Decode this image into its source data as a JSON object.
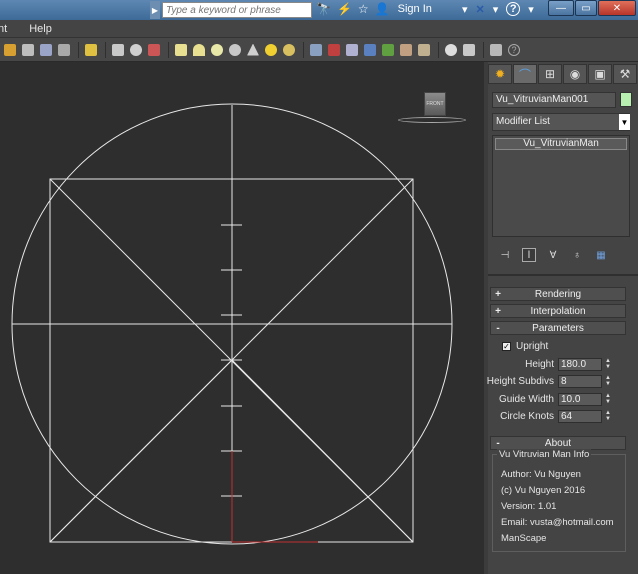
{
  "search": {
    "placeholder": "Type a keyword or phrase"
  },
  "title_bar": {
    "sign_in_label": "Sign In",
    "help_label": "?"
  },
  "menu": {
    "items": [
      "nt",
      "Help"
    ]
  },
  "viewport": {
    "viewcube_label": "FRONT"
  },
  "panel": {
    "object_name": "Vu_VitruvianMan001",
    "object_color": "#b7f0b0",
    "modifier_list_label": "Modifier List",
    "stack_item": "Vu_VitruvianMan",
    "rollouts": {
      "rendering": {
        "sign": "+",
        "label": "Rendering"
      },
      "interpolation": {
        "sign": "+",
        "label": "Interpolation"
      },
      "parameters": {
        "sign": "-",
        "label": "Parameters"
      },
      "about": {
        "sign": "-",
        "label": "About"
      }
    },
    "parameters": {
      "upright_label": "Upright",
      "upright_checked": true,
      "height_label": "Height",
      "height_value": "180.0",
      "height_subdivs_label": "Height Subdivs",
      "height_subdivs_value": "8",
      "guide_width_label": "Guide Width",
      "guide_width_value": "10.0",
      "circle_knots_label": "Circle Knots",
      "circle_knots_value": "64"
    },
    "about": {
      "group_title": "Vu Vitruvian Man Info",
      "author": "Author: Vu Nguyen",
      "copyright": "(c) Vu Nguyen 2016",
      "version": "Version: 1.01",
      "email": "Email: vusta@hotmail.com",
      "product": "ManScape"
    }
  }
}
